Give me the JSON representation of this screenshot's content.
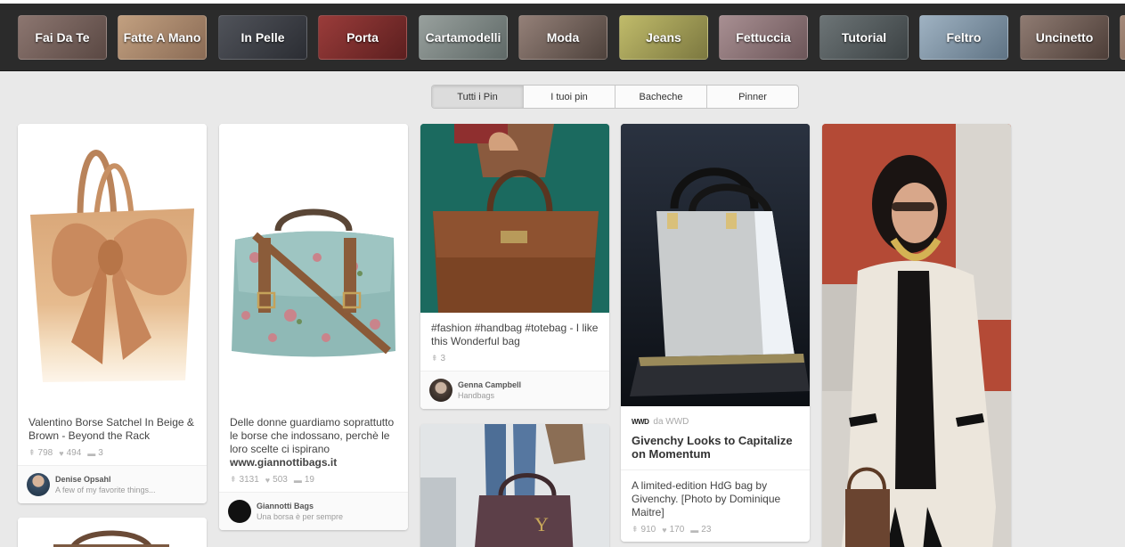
{
  "categories": [
    {
      "label": "Fai Da Te",
      "color": "#6f5a54"
    },
    {
      "label": "Fatte A Mano",
      "color": "#a8856b"
    },
    {
      "label": "In Pelle",
      "color": "#3a3d45"
    },
    {
      "label": "Porta",
      "color": "#7a2c2c"
    },
    {
      "label": "Cartamodelli",
      "color": "#7b8684"
    },
    {
      "label": "Moda",
      "color": "#6a5c55"
    },
    {
      "label": "Jeans",
      "color": "#9a9652"
    },
    {
      "label": "Fettuccia",
      "color": "#8a7376"
    },
    {
      "label": "Tutorial",
      "color": "#525a5c"
    },
    {
      "label": "Feltro",
      "color": "#7a8fa0"
    },
    {
      "label": "Uncinetto",
      "color": "#6b5951"
    }
  ],
  "tabs": [
    {
      "label": "Tutti i Pin",
      "active": true
    },
    {
      "label": "I tuoi pin",
      "active": false
    },
    {
      "label": "Bacheche",
      "active": false
    },
    {
      "label": "Pinner",
      "active": false
    }
  ],
  "pins": {
    "p1": {
      "description": "Valentino Borse Satchel In Beige & Brown - Beyond the Rack",
      "repins": "798",
      "likes": "494",
      "comments": "3",
      "owner_name": "Denise Opsahl",
      "board": "A few of my favorite things..."
    },
    "p2": {
      "description": "Delle donne guardiamo soprattutto le borse che indossano, perchè le loro scelte ci ispirano",
      "link": "www.giannottibags.it",
      "repins": "3131",
      "likes": "503",
      "comments": "19",
      "owner_name": "Giannotti Bags",
      "board": "Una borsa è per sempre"
    },
    "p3": {
      "description": "#fashion #handbag #totebag - I like this Wonderful bag",
      "repins": "3",
      "owner_name": "Genna Campbell",
      "board": "Handbags"
    },
    "p5": {
      "source_logo": "WWD",
      "source": "da WWD",
      "title": "Givenchy Looks to Capitalize on Momentum",
      "description": "A limited-edition HdG bag by Givenchy. [Photo by Dominique Maitre]",
      "repins": "910",
      "likes": "170",
      "comments": "23"
    }
  },
  "icons": {
    "repin": "pin-icon",
    "like": "heart-icon",
    "comment": "speech-bubble-icon"
  }
}
